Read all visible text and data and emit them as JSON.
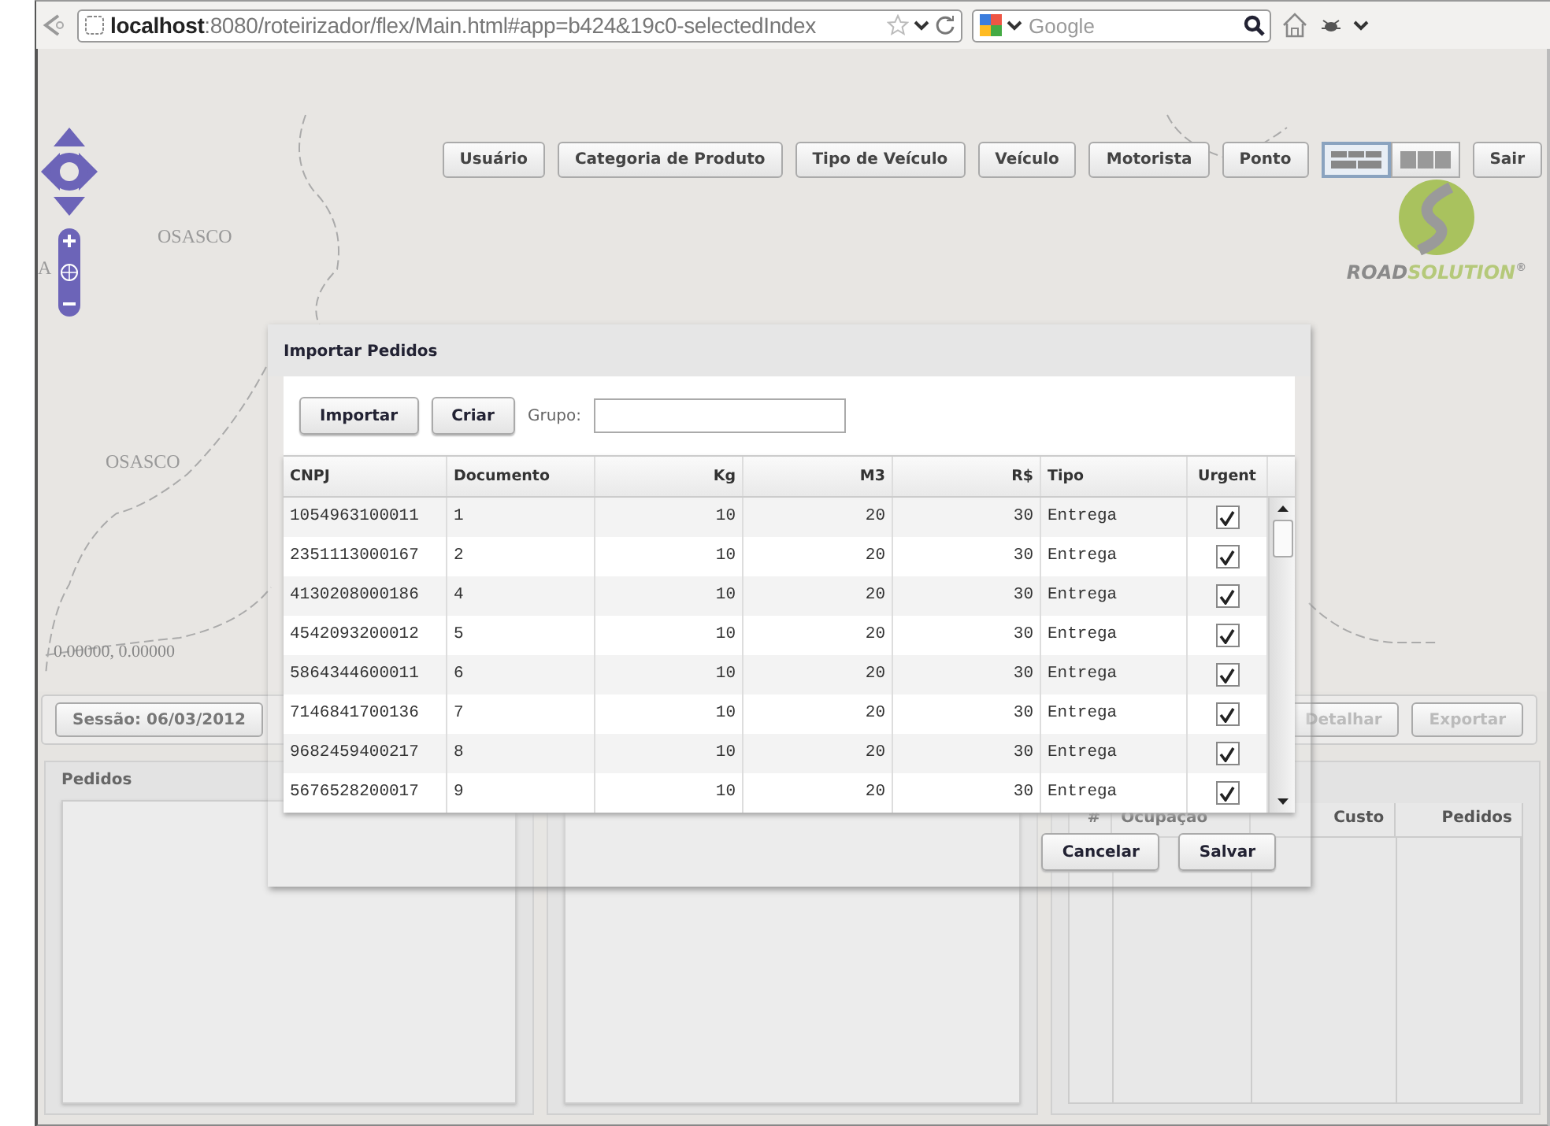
{
  "browser": {
    "url_host": "localhost",
    "url_rest": ":8080/roteirizador/flex/Main.html#app=b424&19c0-selectedIndex",
    "search_placeholder": "Google"
  },
  "toolbar": {
    "buttons": [
      {
        "label": "Usuário"
      },
      {
        "label": "Categoria de Produto"
      },
      {
        "label": "Tipo de Veículo"
      },
      {
        "label": "Veículo"
      },
      {
        "label": "Motorista"
      },
      {
        "label": "Ponto"
      }
    ],
    "layout_toggles": [
      {
        "selected": true
      },
      {
        "selected": false
      }
    ],
    "exit": "Sair"
  },
  "map": {
    "labels": [
      {
        "text": "OSASCO"
      },
      {
        "text": "OSASCO"
      },
      {
        "text": "A"
      }
    ],
    "coordinates": "0.00000, 0.00000",
    "logo": {
      "brand_primary": "ROAD",
      "brand_secondary": "SOLUTION",
      "mark": "®"
    }
  },
  "session_bar": {
    "session": "Sessão: 06/03/2012",
    "buttons": [
      {
        "label": "Detalhar",
        "disabled": true
      },
      {
        "label": "Exportar",
        "disabled": true
      }
    ]
  },
  "orders_panel": {
    "title": "Pedidos"
  },
  "routes_table": {
    "columns": [
      {
        "label": "#"
      },
      {
        "label": "Ocupação"
      },
      {
        "label": "Custo"
      },
      {
        "label": "Pedidos"
      }
    ]
  },
  "dialog": {
    "title": "Importar Pedidos",
    "buttons": [
      {
        "label": "Importar"
      },
      {
        "label": "Criar"
      }
    ],
    "group_label": "Grupo:",
    "table": {
      "columns": [
        {
          "label": "CNPJ"
        },
        {
          "label": "Documento"
        },
        {
          "label": "Kg"
        },
        {
          "label": "M3"
        },
        {
          "label": "R$"
        },
        {
          "label": "Tipo"
        },
        {
          "label": "Urgent"
        }
      ],
      "rows": [
        {
          "cnpj": "1054963100011",
          "documento": "1",
          "kg": "10",
          "m3": "20",
          "rs": "30",
          "tipo": "Entrega",
          "urgente": true
        },
        {
          "cnpj": "2351113000167",
          "documento": "2",
          "kg": "10",
          "m3": "20",
          "rs": "30",
          "tipo": "Entrega",
          "urgente": true
        },
        {
          "cnpj": "4130208000186",
          "documento": "4",
          "kg": "10",
          "m3": "20",
          "rs": "30",
          "tipo": "Entrega",
          "urgente": true
        },
        {
          "cnpj": "4542093200012",
          "documento": "5",
          "kg": "10",
          "m3": "20",
          "rs": "30",
          "tipo": "Entrega",
          "urgente": true
        },
        {
          "cnpj": "5864344600011",
          "documento": "6",
          "kg": "10",
          "m3": "20",
          "rs": "30",
          "tipo": "Entrega",
          "urgente": true
        },
        {
          "cnpj": "7146841700136",
          "documento": "7",
          "kg": "10",
          "m3": "20",
          "rs": "30",
          "tipo": "Entrega",
          "urgente": true
        },
        {
          "cnpj": "9682459400217",
          "documento": "8",
          "kg": "10",
          "m3": "20",
          "rs": "30",
          "tipo": "Entrega",
          "urgente": true
        },
        {
          "cnpj": "5676528200017",
          "documento": "9",
          "kg": "10",
          "m3": "20",
          "rs": "30",
          "tipo": "Entrega",
          "urgente": true
        }
      ]
    },
    "footer_buttons": [
      {
        "label": "Cancelar"
      },
      {
        "label": "Salvar"
      }
    ]
  }
}
